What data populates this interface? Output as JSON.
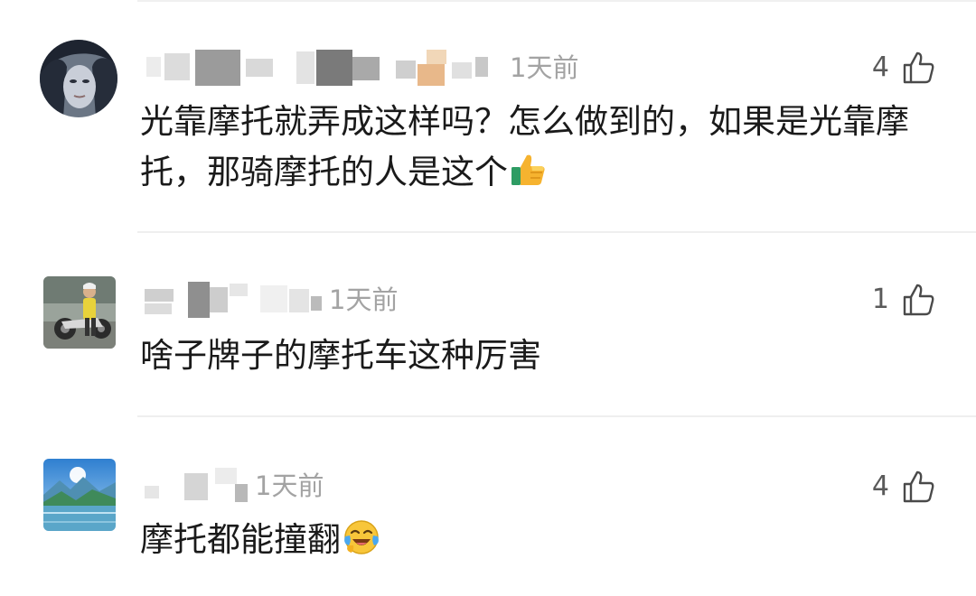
{
  "comments": [
    {
      "username_hidden": true,
      "timestamp": "1天前",
      "likes": "4",
      "text": "光靠摩托就弄成这样吗？怎么做到的，如果是光靠摩托，那骑摩托的人是这个",
      "emoji": "thumbs-up-emoji"
    },
    {
      "username_hidden": true,
      "timestamp": "1天前",
      "likes": "1",
      "text": "啥子牌子的摩托车这种厉害"
    },
    {
      "username_hidden": true,
      "timestamp": "1天前",
      "likes": "4",
      "text": "摩托都能撞翻",
      "emoji": "laughing-crying-emoji"
    }
  ],
  "colors": {
    "text": "#1a1a1a",
    "meta": "#a3a3a3",
    "like": "#5a5a5a",
    "divider": "#efefef"
  }
}
